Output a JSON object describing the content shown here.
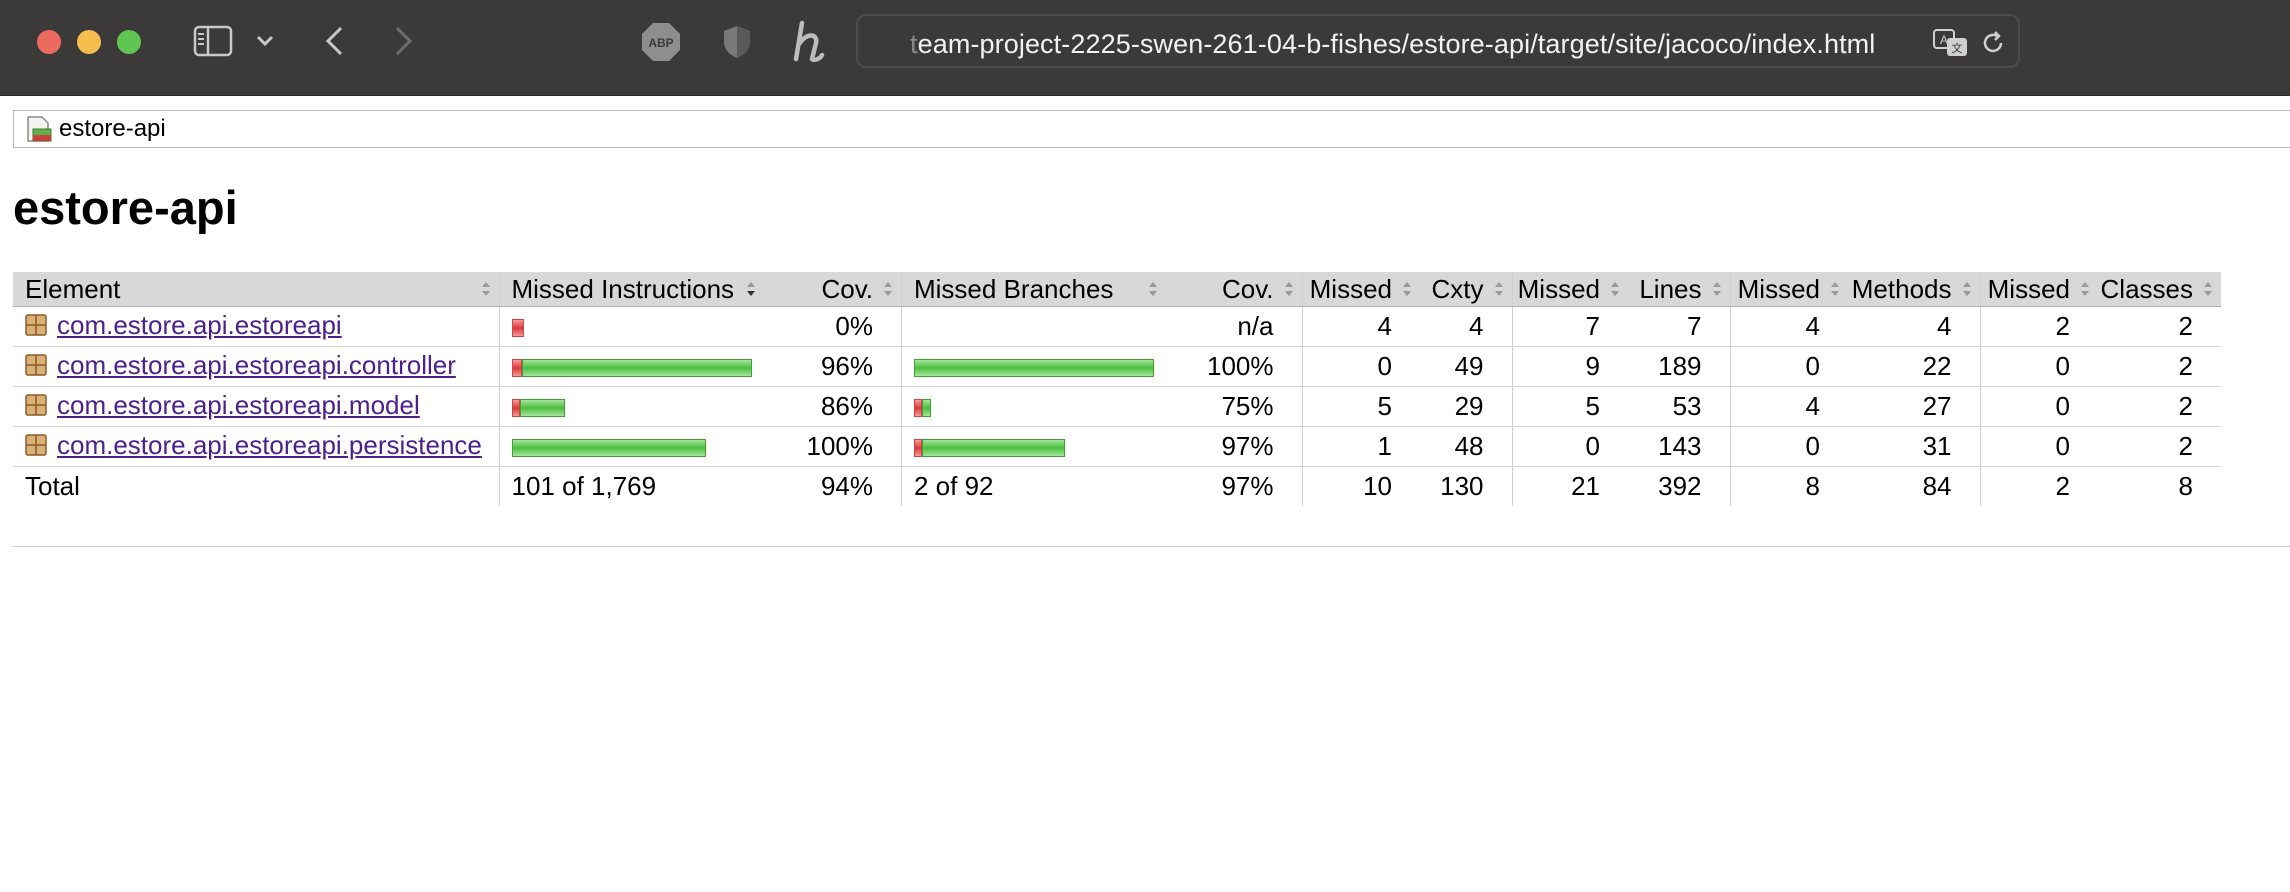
{
  "browser": {
    "url_faded": "t",
    "url": "eam-project-2225-swen-261-04-b-fishes/estore-api/target/site/jacoco/index.html",
    "abp_label": "ABP"
  },
  "breadcrumb": {
    "label": "estore-api"
  },
  "page": {
    "title": "estore-api"
  },
  "table": {
    "headers": {
      "element": "Element",
      "missed_instructions": "Missed Instructions",
      "cov_instr": "Cov.",
      "missed_branches": "Missed Branches",
      "cov_branch": "Cov.",
      "missed_cxty": "Missed",
      "cxty": "Cxty",
      "missed_lines": "Missed",
      "lines": "Lines",
      "missed_methods": "Missed",
      "methods": "Methods",
      "missed_classes": "Missed",
      "classes": "Classes"
    },
    "rows": [
      {
        "element": "com.estore.api.estoreapi",
        "instr_cov": "0%",
        "branch_cov": "n/a",
        "instr_bar": {
          "missed": 1.0,
          "covered": 0.0,
          "scale": 0.05
        },
        "branch_bar": {
          "missed": 0,
          "covered": 0,
          "scale": 0
        },
        "missed_cxty": "4",
        "cxty": "4",
        "missed_lines": "7",
        "lines": "7",
        "missed_methods": "4",
        "methods": "4",
        "missed_classes": "2",
        "classes": "2"
      },
      {
        "element": "com.estore.api.estoreapi.controller",
        "instr_cov": "96%",
        "branch_cov": "100%",
        "instr_bar": {
          "missed": 0.04,
          "covered": 0.96,
          "scale": 1.0
        },
        "branch_bar": {
          "missed": 0.0,
          "covered": 1.0,
          "scale": 1.0
        },
        "missed_cxty": "0",
        "cxty": "49",
        "missed_lines": "9",
        "lines": "189",
        "missed_methods": "0",
        "methods": "22",
        "missed_classes": "0",
        "classes": "2"
      },
      {
        "element": "com.estore.api.estoreapi.model",
        "instr_cov": "86%",
        "branch_cov": "75%",
        "instr_bar": {
          "missed": 0.14,
          "covered": 0.86,
          "scale": 0.22
        },
        "branch_bar": {
          "missed": 0.25,
          "covered": 0.75,
          "scale": 0.07
        },
        "missed_cxty": "5",
        "cxty": "29",
        "missed_lines": "5",
        "lines": "53",
        "missed_methods": "4",
        "methods": "27",
        "missed_classes": "0",
        "classes": "2"
      },
      {
        "element": "com.estore.api.estoreapi.persistence",
        "instr_cov": "100%",
        "branch_cov": "97%",
        "instr_bar": {
          "missed": 0.0,
          "covered": 1.0,
          "scale": 0.81
        },
        "branch_bar": {
          "missed": 0.03,
          "covered": 0.97,
          "scale": 0.63
        },
        "missed_cxty": "1",
        "cxty": "48",
        "missed_lines": "0",
        "lines": "143",
        "missed_methods": "0",
        "methods": "31",
        "missed_classes": "0",
        "classes": "2"
      }
    ],
    "total": {
      "label": "Total",
      "instr": "101 of 1,769",
      "instr_cov": "94%",
      "branch": "2 of 92",
      "branch_cov": "97%",
      "missed_cxty": "10",
      "cxty": "130",
      "missed_lines": "21",
      "lines": "392",
      "missed_methods": "8",
      "methods": "84",
      "missed_classes": "2",
      "classes": "8"
    }
  },
  "colors": {
    "link": "#4b1f8c",
    "bar_green": "#4cbf3f",
    "bar_red": "#d83a3a",
    "header_bg": "#d8d8d8"
  },
  "icons": [
    "close-icon",
    "minimize-icon",
    "maximize-icon",
    "sidebar-icon",
    "chevron-down-icon",
    "back-arrow-icon",
    "forward-arrow-icon",
    "adblock-icon",
    "shield-icon",
    "honey-icon",
    "translate-icon",
    "reload-icon",
    "report-icon",
    "package-icon",
    "sort-icon"
  ]
}
